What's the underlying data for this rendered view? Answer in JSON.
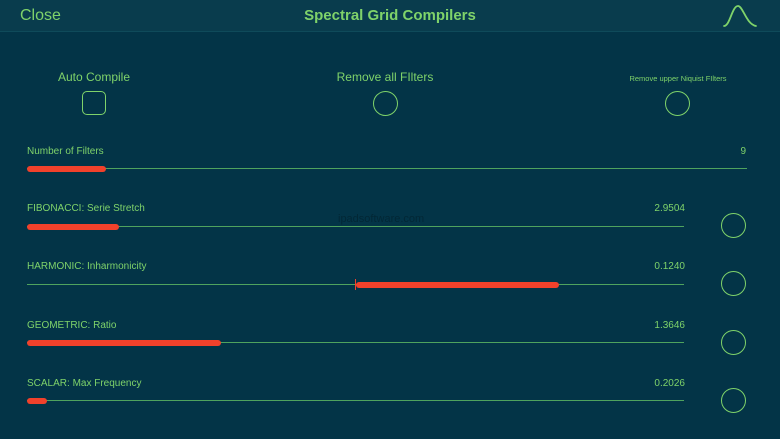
{
  "header": {
    "close_label": "Close",
    "title": "Spectral Grid Compilers",
    "right_icon": "lowpass-filter-curve-icon"
  },
  "options": {
    "auto_compile": {
      "label": "Auto Compile",
      "checked": false
    },
    "remove_all_filters": {
      "label": "Remove all FIlters",
      "selected": false
    },
    "remove_upper_nyquist": {
      "label": "Remove upper Niquist FIlters",
      "selected": false
    }
  },
  "sliders": [
    {
      "label": "Number of Filters",
      "value": "9",
      "fill_start": 0.0,
      "fill_end": 0.11
    },
    {
      "label": "FIBONACCI: Serie Stretch",
      "value": "2.9504",
      "fill_start": 0.0,
      "fill_end": 0.14
    },
    {
      "label": "HARMONIC: Inharmonicity",
      "value": "0.1240",
      "fill_start": 0.5,
      "fill_end": 0.81
    },
    {
      "label": "GEOMETRIC: Ratio",
      "value": "1.3646",
      "fill_start": 0.0,
      "fill_end": 0.295
    },
    {
      "label": "SCALAR: Max Frequency",
      "value": "0.2026",
      "fill_start": 0.0,
      "fill_end": 0.03
    }
  ],
  "watermark": "ipadsoftware.com",
  "colors": {
    "background": "#033447",
    "accent": "#7fd36a",
    "slider_fill": "#f1412b"
  }
}
